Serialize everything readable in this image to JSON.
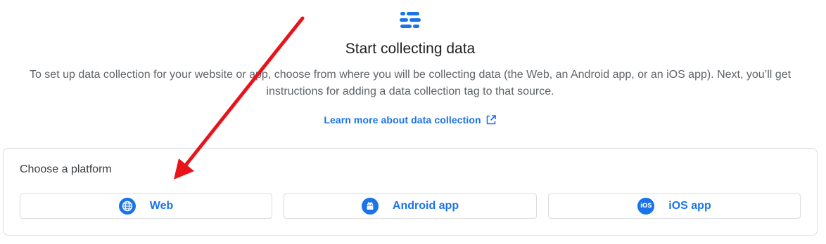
{
  "header": {
    "title": "Start collecting data",
    "description": "To set up data collection for your website or app, choose from where you will be collecting data (the Web, an Android app, or an iOS app). Next, you’ll get instructions for adding a data collection tag to that source.",
    "learn_more_label": "Learn more about data collection"
  },
  "platform_card": {
    "title": "Choose a platform",
    "buttons": [
      {
        "label": "Web",
        "icon": "globe-icon"
      },
      {
        "label": "Android app",
        "icon": "android-icon"
      },
      {
        "label": "iOS app",
        "icon": "ios-icon"
      }
    ],
    "ios_badge_text": "iOS"
  },
  "colors": {
    "accent": "#1a73e8",
    "annotation_arrow": "#e8141a",
    "border": "#dadce0"
  }
}
